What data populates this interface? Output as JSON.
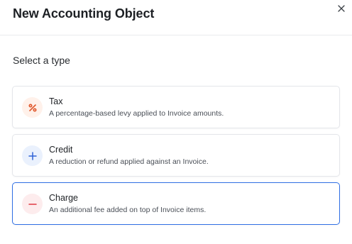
{
  "dialog": {
    "title": "New Accounting Object",
    "close_icon": "close-icon"
  },
  "section_label": "Select a type",
  "options": [
    {
      "title": "Tax",
      "description": "A percentage-based levy applied to Invoice amounts.",
      "icon": "percent-icon",
      "icon_color": "#e0562a",
      "icon_bg": "#fff1ea",
      "selected": false
    },
    {
      "title": "Credit",
      "description": "A reduction or refund applied against an Invoice.",
      "icon": "plus-icon",
      "icon_color": "#2f63d6",
      "icon_bg": "#eaf1fd",
      "selected": false
    },
    {
      "title": "Charge",
      "description": "An additional fee added on top of Invoice items.",
      "icon": "minus-icon",
      "icon_color": "#e03a44",
      "icon_bg": "#fdeced",
      "selected": true
    }
  ],
  "colors": {
    "selected_border": "#2f6fe4"
  }
}
